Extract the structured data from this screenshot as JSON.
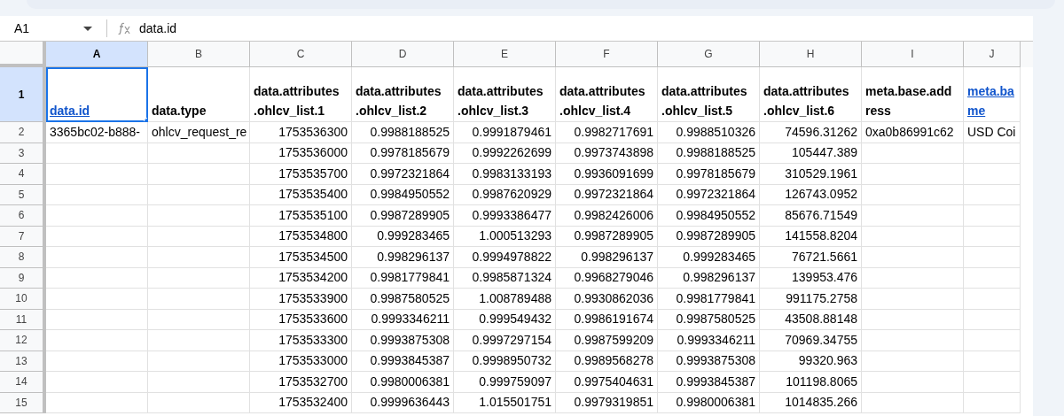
{
  "name_box": {
    "value": "A1"
  },
  "formula_bar": {
    "value": "data.id"
  },
  "columns": [
    {
      "label": "A",
      "selected": true
    },
    {
      "label": "B",
      "selected": false
    },
    {
      "label": "C",
      "selected": false
    },
    {
      "label": "D",
      "selected": false
    },
    {
      "label": "E",
      "selected": false
    },
    {
      "label": "F",
      "selected": false
    },
    {
      "label": "G",
      "selected": false
    },
    {
      "label": "H",
      "selected": false
    },
    {
      "label": "I",
      "selected": false
    },
    {
      "label": "J",
      "selected": false
    }
  ],
  "rows": [
    {
      "number": "1",
      "selected": true,
      "cells": [
        {
          "text": "data.id",
          "kind": "link",
          "selected": true
        },
        {
          "text": "data.type",
          "kind": "header",
          "selected": false
        },
        {
          "text": "data.attributes\n.ohlcv_list.1",
          "kind": "header",
          "selected": false
        },
        {
          "text": "data.attributes\n.ohlcv_list.2",
          "kind": "header",
          "selected": false
        },
        {
          "text": "data.attributes\n.ohlcv_list.3",
          "kind": "header",
          "selected": false
        },
        {
          "text": "data.attributes\n.ohlcv_list.4",
          "kind": "header",
          "selected": false
        },
        {
          "text": "data.attributes\n.ohlcv_list.5",
          "kind": "header",
          "selected": false
        },
        {
          "text": "data.attributes\n.ohlcv_list.6",
          "kind": "header",
          "selected": false
        },
        {
          "text": "meta.base.add\nress",
          "kind": "header",
          "selected": false
        },
        {
          "text": "meta.ba\nme",
          "kind": "link",
          "selected": false
        }
      ]
    },
    {
      "number": "2",
      "selected": false,
      "cells": [
        {
          "text": "3365bc02-b888-",
          "kind": "text",
          "selected": false
        },
        {
          "text": "ohlcv_request_re",
          "kind": "text",
          "selected": false
        },
        {
          "text": "1753536300",
          "kind": "number",
          "selected": false
        },
        {
          "text": "0.9988188525",
          "kind": "number",
          "selected": false
        },
        {
          "text": "0.9991879461",
          "kind": "number",
          "selected": false
        },
        {
          "text": "0.9982717691",
          "kind": "number",
          "selected": false
        },
        {
          "text": "0.9988510326",
          "kind": "number",
          "selected": false
        },
        {
          "text": "74596.31262",
          "kind": "number",
          "selected": false
        },
        {
          "text": "0xa0b86991c62",
          "kind": "text",
          "selected": false
        },
        {
          "text": "USD Coi",
          "kind": "text",
          "selected": false
        }
      ]
    },
    {
      "number": "3",
      "selected": false,
      "cells": [
        {
          "selected": false
        },
        {
          "selected": false
        },
        {
          "text": "1753536000",
          "kind": "number",
          "selected": false
        },
        {
          "text": "0.9978185679",
          "kind": "number",
          "selected": false
        },
        {
          "text": "0.9992262699",
          "kind": "number",
          "selected": false
        },
        {
          "text": "0.9973743898",
          "kind": "number",
          "selected": false
        },
        {
          "text": "0.9988188525",
          "kind": "number",
          "selected": false
        },
        {
          "text": "105447.389",
          "kind": "number",
          "selected": false
        },
        {
          "selected": false
        },
        {
          "selected": false
        }
      ]
    },
    {
      "number": "4",
      "selected": false,
      "cells": [
        {
          "selected": false
        },
        {
          "selected": false
        },
        {
          "text": "1753535700",
          "kind": "number",
          "selected": false
        },
        {
          "text": "0.9972321864",
          "kind": "number",
          "selected": false
        },
        {
          "text": "0.9983133193",
          "kind": "number",
          "selected": false
        },
        {
          "text": "0.9936091699",
          "kind": "number",
          "selected": false
        },
        {
          "text": "0.9978185679",
          "kind": "number",
          "selected": false
        },
        {
          "text": "310529.1961",
          "kind": "number",
          "selected": false
        },
        {
          "selected": false
        },
        {
          "selected": false
        }
      ]
    },
    {
      "number": "5",
      "selected": false,
      "cells": [
        {
          "selected": false
        },
        {
          "selected": false
        },
        {
          "text": "1753535400",
          "kind": "number",
          "selected": false
        },
        {
          "text": "0.9984950552",
          "kind": "number",
          "selected": false
        },
        {
          "text": "0.9987620929",
          "kind": "number",
          "selected": false
        },
        {
          "text": "0.9972321864",
          "kind": "number",
          "selected": false
        },
        {
          "text": "0.9972321864",
          "kind": "number",
          "selected": false
        },
        {
          "text": "126743.0952",
          "kind": "number",
          "selected": false
        },
        {
          "selected": false
        },
        {
          "selected": false
        }
      ]
    },
    {
      "number": "6",
      "selected": false,
      "cells": [
        {
          "selected": false
        },
        {
          "selected": false
        },
        {
          "text": "1753535100",
          "kind": "number",
          "selected": false
        },
        {
          "text": "0.9987289905",
          "kind": "number",
          "selected": false
        },
        {
          "text": "0.9993386477",
          "kind": "number",
          "selected": false
        },
        {
          "text": "0.9982426006",
          "kind": "number",
          "selected": false
        },
        {
          "text": "0.9984950552",
          "kind": "number",
          "selected": false
        },
        {
          "text": "85676.71549",
          "kind": "number",
          "selected": false
        },
        {
          "selected": false
        },
        {
          "selected": false
        }
      ]
    },
    {
      "number": "7",
      "selected": false,
      "cells": [
        {
          "selected": false
        },
        {
          "selected": false
        },
        {
          "text": "1753534800",
          "kind": "number",
          "selected": false
        },
        {
          "text": "0.999283465",
          "kind": "number",
          "selected": false
        },
        {
          "text": "1.000513293",
          "kind": "number",
          "selected": false
        },
        {
          "text": "0.9987289905",
          "kind": "number",
          "selected": false
        },
        {
          "text": "0.9987289905",
          "kind": "number",
          "selected": false
        },
        {
          "text": "141558.8204",
          "kind": "number",
          "selected": false
        },
        {
          "selected": false
        },
        {
          "selected": false
        }
      ]
    },
    {
      "number": "8",
      "selected": false,
      "cells": [
        {
          "selected": false
        },
        {
          "selected": false
        },
        {
          "text": "1753534500",
          "kind": "number",
          "selected": false
        },
        {
          "text": "0.998296137",
          "kind": "number",
          "selected": false
        },
        {
          "text": "0.9994978822",
          "kind": "number",
          "selected": false
        },
        {
          "text": "0.998296137",
          "kind": "number",
          "selected": false
        },
        {
          "text": "0.999283465",
          "kind": "number",
          "selected": false
        },
        {
          "text": "76721.5661",
          "kind": "number",
          "selected": false
        },
        {
          "selected": false
        },
        {
          "selected": false
        }
      ]
    },
    {
      "number": "9",
      "selected": false,
      "cells": [
        {
          "selected": false
        },
        {
          "selected": false
        },
        {
          "text": "1753534200",
          "kind": "number",
          "selected": false
        },
        {
          "text": "0.9981779841",
          "kind": "number",
          "selected": false
        },
        {
          "text": "0.9985871324",
          "kind": "number",
          "selected": false
        },
        {
          "text": "0.9968279046",
          "kind": "number",
          "selected": false
        },
        {
          "text": "0.998296137",
          "kind": "number",
          "selected": false
        },
        {
          "text": "139953.476",
          "kind": "number",
          "selected": false
        },
        {
          "selected": false
        },
        {
          "selected": false
        }
      ]
    },
    {
      "number": "10",
      "selected": false,
      "cells": [
        {
          "selected": false
        },
        {
          "selected": false
        },
        {
          "text": "1753533900",
          "kind": "number",
          "selected": false
        },
        {
          "text": "0.9987580525",
          "kind": "number",
          "selected": false
        },
        {
          "text": "1.008789488",
          "kind": "number",
          "selected": false
        },
        {
          "text": "0.9930862036",
          "kind": "number",
          "selected": false
        },
        {
          "text": "0.9981779841",
          "kind": "number",
          "selected": false
        },
        {
          "text": "991175.2758",
          "kind": "number",
          "selected": false
        },
        {
          "selected": false
        },
        {
          "selected": false
        }
      ]
    },
    {
      "number": "11",
      "selected": false,
      "cells": [
        {
          "selected": false
        },
        {
          "selected": false
        },
        {
          "text": "1753533600",
          "kind": "number",
          "selected": false
        },
        {
          "text": "0.9993346211",
          "kind": "number",
          "selected": false
        },
        {
          "text": "0.999549432",
          "kind": "number",
          "selected": false
        },
        {
          "text": "0.9986191674",
          "kind": "number",
          "selected": false
        },
        {
          "text": "0.9987580525",
          "kind": "number",
          "selected": false
        },
        {
          "text": "43508.88148",
          "kind": "number",
          "selected": false
        },
        {
          "selected": false
        },
        {
          "selected": false
        }
      ]
    },
    {
      "number": "12",
      "selected": false,
      "cells": [
        {
          "selected": false
        },
        {
          "selected": false
        },
        {
          "text": "1753533300",
          "kind": "number",
          "selected": false
        },
        {
          "text": "0.9993875308",
          "kind": "number",
          "selected": false
        },
        {
          "text": "0.9997297154",
          "kind": "number",
          "selected": false
        },
        {
          "text": "0.9987599209",
          "kind": "number",
          "selected": false
        },
        {
          "text": "0.9993346211",
          "kind": "number",
          "selected": false
        },
        {
          "text": "70969.34755",
          "kind": "number",
          "selected": false
        },
        {
          "selected": false
        },
        {
          "selected": false
        }
      ]
    },
    {
      "number": "13",
      "selected": false,
      "cells": [
        {
          "selected": false
        },
        {
          "selected": false
        },
        {
          "text": "1753533000",
          "kind": "number",
          "selected": false
        },
        {
          "text": "0.9993845387",
          "kind": "number",
          "selected": false
        },
        {
          "text": "0.9998950732",
          "kind": "number",
          "selected": false
        },
        {
          "text": "0.9989568278",
          "kind": "number",
          "selected": false
        },
        {
          "text": "0.9993875308",
          "kind": "number",
          "selected": false
        },
        {
          "text": "99320.963",
          "kind": "number",
          "selected": false
        },
        {
          "selected": false
        },
        {
          "selected": false
        }
      ]
    },
    {
      "number": "14",
      "selected": false,
      "cells": [
        {
          "selected": false
        },
        {
          "selected": false
        },
        {
          "text": "1753532700",
          "kind": "number",
          "selected": false
        },
        {
          "text": "0.9980006381",
          "kind": "number",
          "selected": false
        },
        {
          "text": "0.999759097",
          "kind": "number",
          "selected": false
        },
        {
          "text": "0.9975404631",
          "kind": "number",
          "selected": false
        },
        {
          "text": "0.9993845387",
          "kind": "number",
          "selected": false
        },
        {
          "text": "101198.8065",
          "kind": "number",
          "selected": false
        },
        {
          "selected": false
        },
        {
          "selected": false
        }
      ]
    },
    {
      "number": "15",
      "selected": false,
      "cells": [
        {
          "selected": false
        },
        {
          "selected": false
        },
        {
          "text": "1753532400",
          "kind": "number",
          "selected": false
        },
        {
          "text": "0.9999636443",
          "kind": "number",
          "selected": false
        },
        {
          "text": "1.015501751",
          "kind": "number",
          "selected": false
        },
        {
          "text": "0.9979319851",
          "kind": "number",
          "selected": false
        },
        {
          "text": "0.9980006381",
          "kind": "number",
          "selected": false
        },
        {
          "text": "1014835.266",
          "kind": "number",
          "selected": false
        },
        {
          "selected": false
        },
        {
          "selected": false
        }
      ]
    }
  ]
}
